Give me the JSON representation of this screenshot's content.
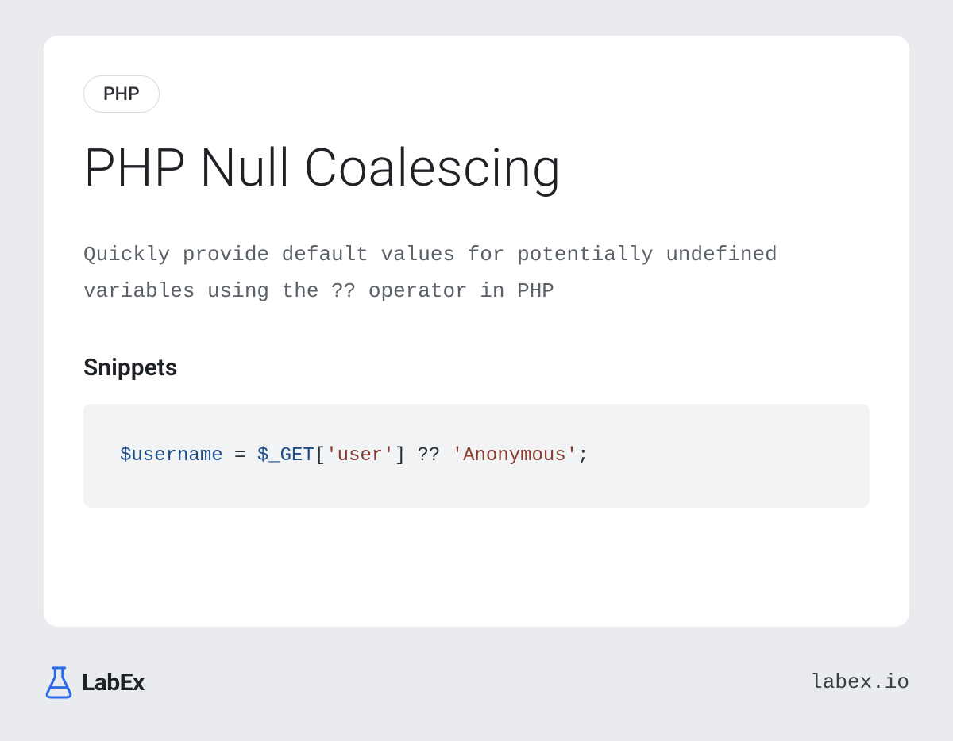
{
  "tag": "PHP",
  "title": "PHP Null Coalescing",
  "description": "Quickly provide default values for potentially undefined variables using the ?? operator in PHP",
  "snippets_heading": "Snippets",
  "code": {
    "var1": "$username",
    "eq": " = ",
    "var2": "$_GET",
    "after_var2": "[",
    "str1": "'user'",
    "mid": "] ?? ",
    "str2": "'Anonymous'",
    "end": ";"
  },
  "brand": "LabEx",
  "url": "labex.io"
}
